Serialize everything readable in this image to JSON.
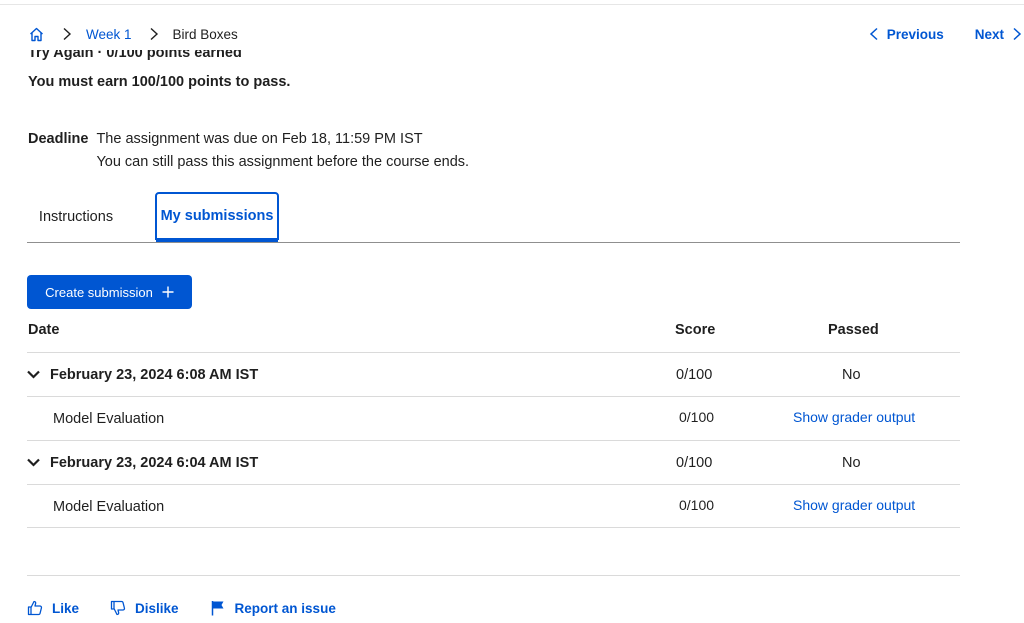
{
  "breadcrumb": {
    "home_icon": "home-icon",
    "items": [
      "Week 1",
      "Bird Boxes"
    ]
  },
  "pager": {
    "previous": "Previous",
    "next": "Next"
  },
  "grade": {
    "cut_line": "Try Again · 0/100 points earned",
    "pass_requirement": "You must earn 100/100 points to pass."
  },
  "deadline": {
    "label": "Deadline",
    "line1": "The assignment was due on Feb 18, 11:59 PM IST",
    "line2": "You can still pass this assignment before the course ends."
  },
  "tabs": [
    {
      "label": "Instructions",
      "active": false
    },
    {
      "label": "My submissions",
      "active": true
    }
  ],
  "create_button": "Create submission",
  "table": {
    "headers": {
      "date": "Date",
      "score": "Score",
      "passed": "Passed"
    },
    "submissions": [
      {
        "date": "February 23, 2024 6:08 AM IST",
        "score": "0/100",
        "passed": "No",
        "child": {
          "name": "Model Evaluation",
          "score": "0/100",
          "link": "Show grader output"
        }
      },
      {
        "date": "February 23, 2024 6:04 AM IST",
        "score": "0/100",
        "passed": "No",
        "child": {
          "name": "Model Evaluation",
          "score": "0/100",
          "link": "Show grader output"
        }
      }
    ]
  },
  "footer": {
    "like": "Like",
    "dislike": "Dislike",
    "report": "Report an issue"
  },
  "colors": {
    "accent": "#0056d2",
    "text": "#1f1f1f",
    "divider": "#dadada"
  }
}
